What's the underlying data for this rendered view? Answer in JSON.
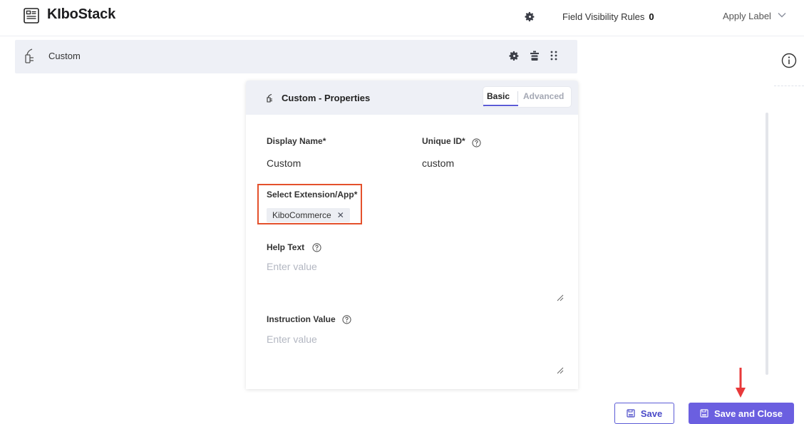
{
  "header": {
    "title": "KIboStack",
    "field_visibility_label": "Field Visibility Rules",
    "field_visibility_count": "0",
    "apply_label": "Apply Label"
  },
  "field_row": {
    "label": "Custom"
  },
  "panel": {
    "title": "Custom - Properties",
    "tabs": [
      {
        "label": "Basic",
        "active": true
      },
      {
        "label": "Advanced",
        "active": false
      }
    ],
    "display_name": {
      "label": "Display Name*",
      "value": "Custom"
    },
    "unique_id": {
      "label": "Unique ID*",
      "value": "custom"
    },
    "extension": {
      "label": "Select Extension/App*",
      "selected": "KiboCommerce",
      "remove_glyph": "✕"
    },
    "help_text": {
      "label": "Help Text",
      "placeholder": "Enter value"
    },
    "instruction_value": {
      "label": "Instruction Value",
      "placeholder": "Enter value"
    }
  },
  "footer": {
    "save_label": "Save",
    "save_close_label": "Save and Close"
  },
  "colors": {
    "accent": "#6b5fe0",
    "highlight_border": "#e4512c",
    "annotation_arrow": "#e8393a",
    "row_bg": "#eef0f6"
  }
}
